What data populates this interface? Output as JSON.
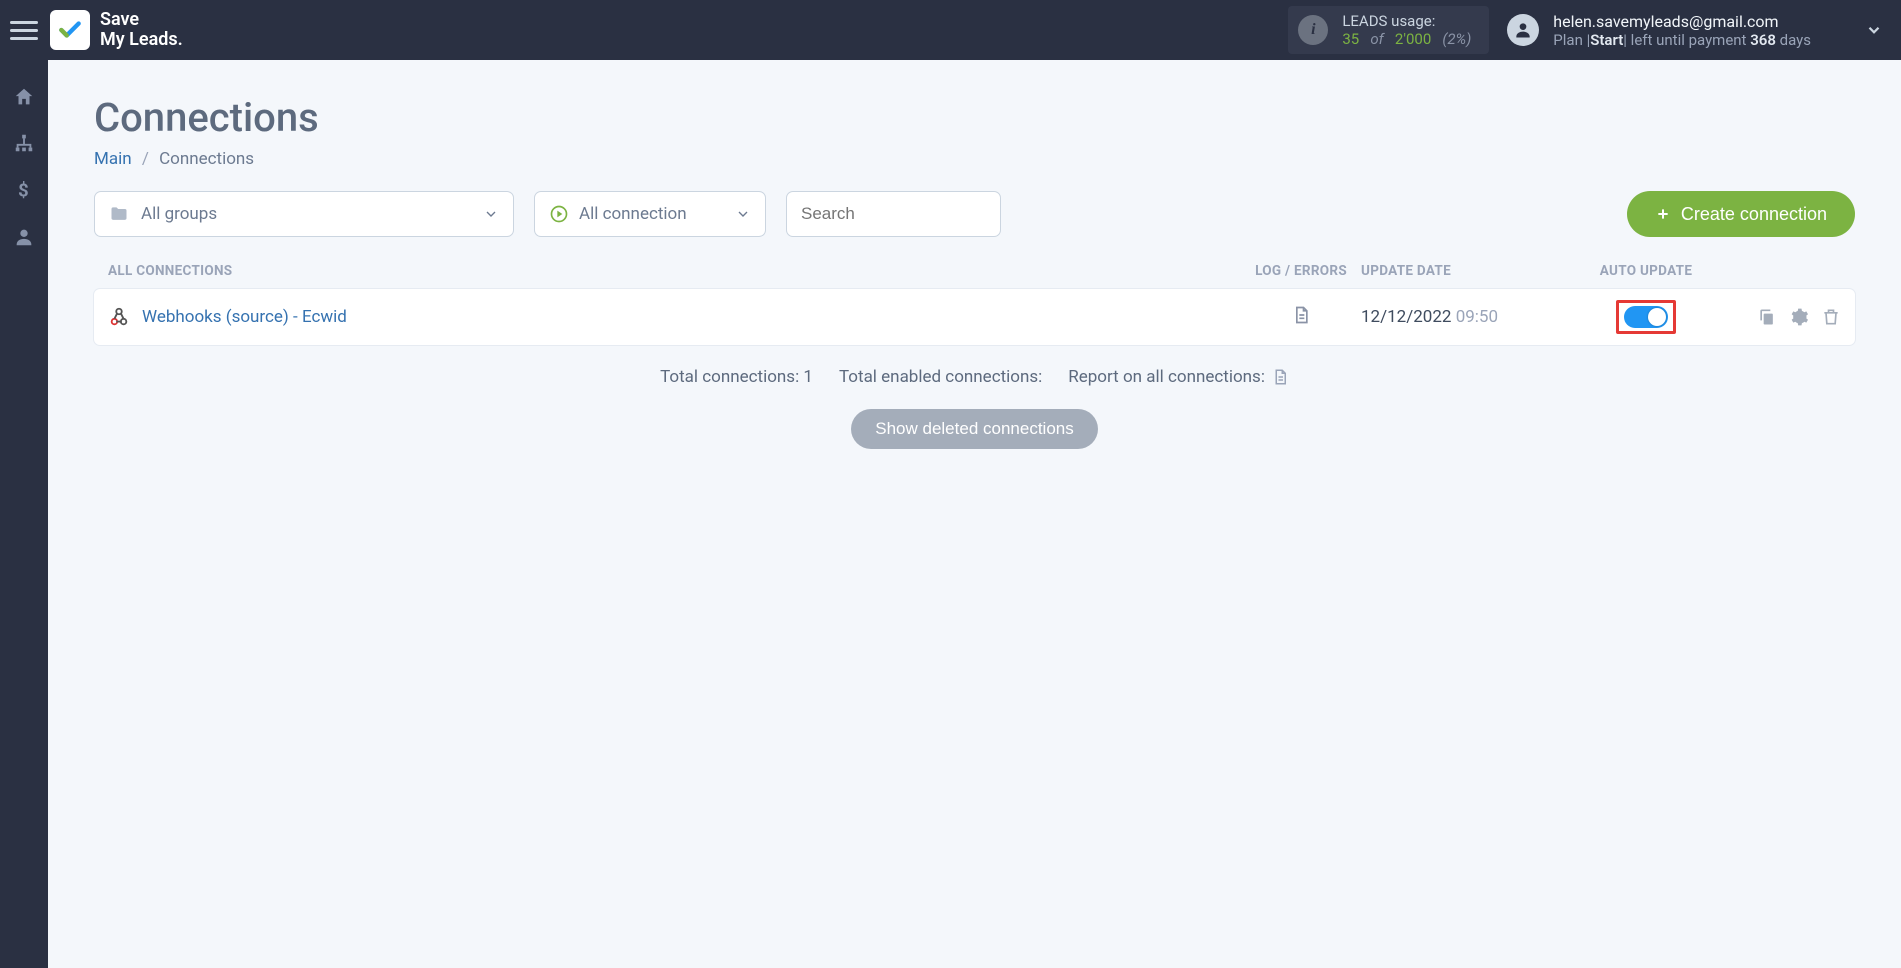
{
  "brand": {
    "line1": "Save",
    "line2": "My Leads."
  },
  "leads_usage": {
    "label": "LEADS usage:",
    "used": "35",
    "of": "of",
    "quota": "2'000",
    "pct": "(2%)"
  },
  "user": {
    "email": "helen.savemyleads@gmail.com",
    "plan_prefix": "Plan |",
    "plan_name": "Start",
    "plan_mid": "|  left until payment ",
    "days": "368",
    "plan_suffix": " days"
  },
  "page": {
    "title": "Connections",
    "crumb_home": "Main",
    "crumb_current": "Connections"
  },
  "filters": {
    "groups_label": "All groups",
    "conn_label": "All connection",
    "search_placeholder": "Search",
    "create_btn": "Create connection"
  },
  "columns": {
    "name": "ALL CONNECTIONS",
    "log": "LOG / ERRORS",
    "date": "UPDATE DATE",
    "auto": "AUTO UPDATE"
  },
  "rows": [
    {
      "title": "Webhooks (source) - Ecwid",
      "date": "12/12/2022",
      "time": "09:50",
      "auto_on": true
    }
  ],
  "summary": {
    "total_label": "Total connections: ",
    "total_val": "1",
    "enabled_label": "Total enabled connections:",
    "report_label": "Report on all connections:"
  },
  "show_deleted": "Show deleted connections"
}
